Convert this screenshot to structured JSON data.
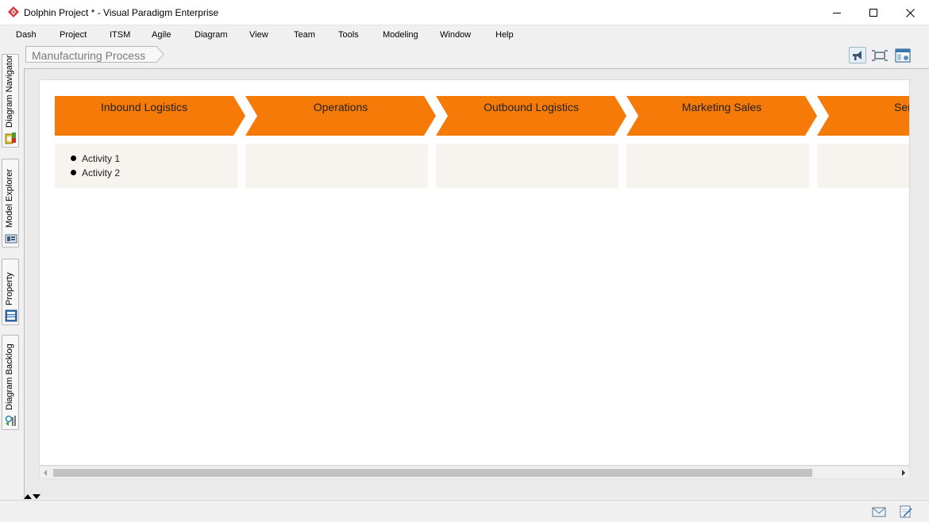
{
  "window": {
    "title": "Dolphin Project * - Visual Paradigm Enterprise",
    "icon": "visual-paradigm-logo",
    "controls": [
      "minimize",
      "maximize",
      "close"
    ]
  },
  "menu": [
    {
      "label": "Dash"
    },
    {
      "label": "Project"
    },
    {
      "label": "ITSM"
    },
    {
      "label": "Agile"
    },
    {
      "label": "Diagram"
    },
    {
      "label": "View"
    },
    {
      "label": "Team"
    },
    {
      "label": "Tools"
    },
    {
      "label": "Modeling"
    },
    {
      "label": "Window"
    },
    {
      "label": "Help"
    }
  ],
  "side_tabs": [
    {
      "label": "Diagram Navigator",
      "icon": "diagram-navigator-icon"
    },
    {
      "label": "Model Explorer",
      "icon": "model-explorer-icon"
    },
    {
      "label": "Property",
      "icon": "property-icon"
    },
    {
      "label": "Diagram Backlog",
      "icon": "diagram-backlog-icon"
    }
  ],
  "breadcrumb": {
    "label": "Manufacturing Process"
  },
  "toolbar": {
    "buttons": [
      {
        "icon": "announce-icon",
        "selected": true
      },
      {
        "icon": "fit-diagram-icon",
        "selected": false
      },
      {
        "icon": "layout-panel-icon",
        "selected": false
      }
    ]
  },
  "diagram": {
    "colors": {
      "stage_fill": "#f57a07",
      "activity_fill": "#f7f3ee"
    },
    "stages": [
      {
        "label": "Inbound Logistics",
        "activities": [
          "Activity 1",
          "Activity 2"
        ]
      },
      {
        "label": "Operations",
        "activities": []
      },
      {
        "label": "Outbound Logistics",
        "activities": []
      },
      {
        "label": "Marketing Sales",
        "activities": []
      },
      {
        "label": "Ser",
        "activities": []
      }
    ]
  },
  "statusbar": {
    "icons": [
      "mail-icon",
      "edit-document-icon"
    ]
  }
}
